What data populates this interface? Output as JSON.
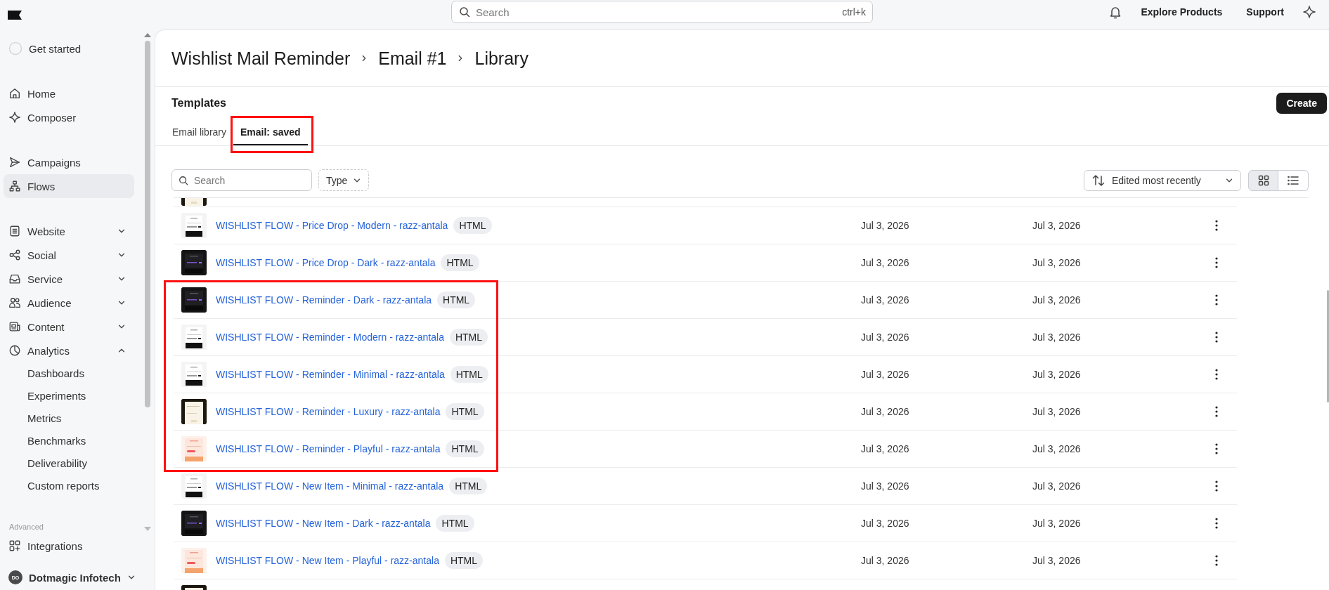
{
  "topbar": {
    "search": {
      "placeholder": "Search",
      "shortcut": "ctrl+k"
    },
    "links": [
      "Explore Products",
      "Support"
    ]
  },
  "sidebar": {
    "get_started": "Get started",
    "groups": [
      {
        "items": [
          {
            "label": "Home",
            "selected": false
          },
          {
            "label": "Composer",
            "selected": false
          }
        ]
      },
      {
        "items": [
          {
            "label": "Campaigns",
            "selected": false
          },
          {
            "label": "Flows",
            "selected": true
          }
        ]
      },
      {
        "items": [
          {
            "label": "Website",
            "selected": false,
            "expanded": false
          },
          {
            "label": "Social",
            "selected": false,
            "expanded": false
          },
          {
            "label": "Service",
            "selected": false,
            "expanded": false
          },
          {
            "label": "Audience",
            "selected": false,
            "expanded": false
          },
          {
            "label": "Content",
            "selected": false,
            "expanded": false
          },
          {
            "label": "Analytics",
            "selected": false,
            "expanded": true,
            "children": [
              "Dashboards",
              "Experiments",
              "Metrics",
              "Benchmarks",
              "Deliverability",
              "Custom reports"
            ]
          }
        ]
      },
      {
        "label": "Advanced",
        "items": [
          {
            "label": "Integrations",
            "selected": false
          }
        ]
      }
    ],
    "workspace": {
      "initials": "DO",
      "name": "Dotmagic Infotech"
    }
  },
  "breadcrumb": [
    "Wishlist Mail Reminder",
    "Email #1",
    "Library"
  ],
  "section_title": "Templates",
  "create_button": "Create",
  "tabs": [
    {
      "label": "Email library",
      "selected": false,
      "highlighted": false
    },
    {
      "label": "Email: saved",
      "selected": true,
      "highlighted": true
    }
  ],
  "filters": {
    "search_placeholder": "Search",
    "type_filter": "Type",
    "sort": "Edited most recently",
    "view_modes": [
      {
        "kind": "grid",
        "selected": true
      },
      {
        "kind": "list",
        "selected": false
      }
    ]
  },
  "table": {
    "rows": [
      {
        "kind": "clipped"
      },
      {
        "kind": "full",
        "name": "WISHLIST FLOW - Price Drop - Modern - razz-antala",
        "badge": "HTML",
        "column_2": "Jul 3, 2026",
        "column_3": "Jul 3, 2026",
        "highlighted": false
      },
      {
        "kind": "full",
        "name": "WISHLIST FLOW - Price Drop - Dark - razz-antala",
        "badge": "HTML",
        "column_2": "Jul 3, 2026",
        "column_3": "Jul 3, 2026",
        "highlighted": false
      },
      {
        "kind": "full",
        "name": "WISHLIST FLOW - Reminder - Dark - razz-antala",
        "badge": "HTML",
        "column_2": "Jul 3, 2026",
        "column_3": "Jul 3, 2026",
        "highlighted": true
      },
      {
        "kind": "full",
        "name": "WISHLIST FLOW - Reminder - Modern - razz-antala",
        "badge": "HTML",
        "column_2": "Jul 3, 2026",
        "column_3": "Jul 3, 2026",
        "highlighted": true
      },
      {
        "kind": "full",
        "name": "WISHLIST FLOW - Reminder - Minimal - razz-antala",
        "badge": "HTML",
        "column_2": "Jul 3, 2026",
        "column_3": "Jul 3, 2026",
        "highlighted": true
      },
      {
        "kind": "full",
        "name": "WISHLIST FLOW - Reminder - Luxury - razz-antala",
        "badge": "HTML",
        "column_2": "Jul 3, 2026",
        "column_3": "Jul 3, 2026",
        "highlighted": true
      },
      {
        "kind": "full",
        "name": "WISHLIST FLOW - Reminder - Playful - razz-antala",
        "badge": "HTML",
        "column_2": "Jul 3, 2026",
        "column_3": "Jul 3, 2026",
        "highlighted": true
      },
      {
        "kind": "full",
        "name": "WISHLIST FLOW - New Item - Minimal - razz-antala",
        "badge": "HTML",
        "column_2": "Jul 3, 2026",
        "column_3": "Jul 3, 2026",
        "highlighted": false
      },
      {
        "kind": "full",
        "name": "WISHLIST FLOW - New Item - Dark - razz-antala",
        "badge": "HTML",
        "column_2": "Jul 3, 2026",
        "column_3": "Jul 3, 2026",
        "highlighted": false
      },
      {
        "kind": "full",
        "name": "WISHLIST FLOW - New Item - Playful - razz-antala",
        "badge": "HTML",
        "column_2": "Jul 3, 2026",
        "column_3": "Jul 3, 2026",
        "highlighted": false
      },
      {
        "kind": "clipped"
      }
    ]
  }
}
